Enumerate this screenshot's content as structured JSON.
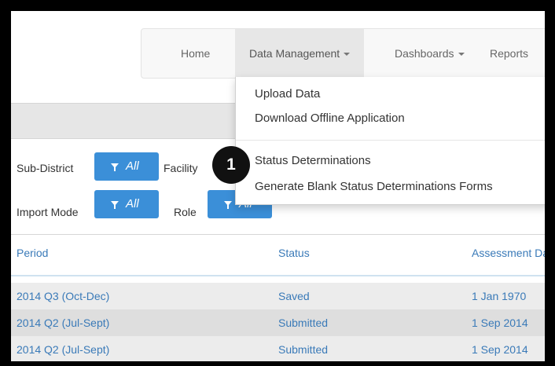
{
  "navbar": {
    "home": "Home",
    "data_management": "Data Management",
    "dashboards": "Dashboards",
    "reports": "Reports"
  },
  "dropdown": {
    "upload_data": "Upload Data",
    "download_offline": "Download Offline Application",
    "status_determinations": "Status Determinations",
    "generate_blank": "Generate Blank Status Determinations Forms"
  },
  "filters": {
    "sub_district_label": "Sub-District",
    "sub_district_value": "All",
    "facility_label": "Facility",
    "import_mode_label": "Import Mode",
    "import_mode_value": "All",
    "role_label": "Role",
    "role_value": "All",
    "filter_icon": "filter-icon"
  },
  "callout": {
    "number": "1"
  },
  "table": {
    "headers": [
      "Period",
      "Status",
      "Assessment Date"
    ],
    "rows": [
      [
        "2014 Q3 (Oct-Dec)",
        "Saved",
        "1 Jan 1970"
      ],
      [
        "2014 Q2 (Jul-Sept)",
        "Submitted",
        "1 Sep 2014"
      ],
      [
        "2014 Q2 (Jul-Sept)",
        "Submitted",
        "1 Sep 2014"
      ]
    ]
  },
  "colors": {
    "accent": "#3b8fd8",
    "link": "#3a7ab8",
    "border_frame": "#000000"
  }
}
